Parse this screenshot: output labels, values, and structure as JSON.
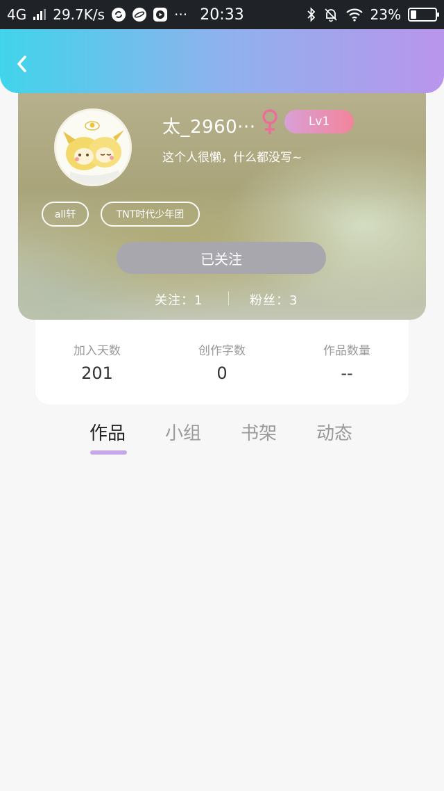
{
  "status_bar": {
    "network": "4G",
    "speed": "29.7K/s",
    "more": "···",
    "time": "20:33",
    "battery": "23%",
    "battery_level": 0.23,
    "icons": [
      "signal-icon",
      "sync-icon",
      "planet-icon",
      "play-icon",
      "bluetooth-icon",
      "mute-bell-icon",
      "wifi-icon",
      "battery-icon"
    ]
  },
  "header": {
    "back_icon": "chevron-left-icon",
    "colors": {
      "start": "#40d4ea",
      "mid": "#8eb2ed",
      "end": "#b995ec"
    }
  },
  "profile": {
    "username": "太_2960···",
    "gender_icon": "female-icon",
    "gender_color": "#e96f99",
    "level": "Lv1",
    "bio": "这个人很懒，什么都没写~",
    "tags": [
      "all轩",
      "TNT时代少年团"
    ],
    "follow_button": "已关注",
    "following_label": "关注：1",
    "fans_label": "粉丝：3"
  },
  "stats": [
    {
      "label": "加入天数",
      "value": "201"
    },
    {
      "label": "创作字数",
      "value": "0"
    },
    {
      "label": "作品数量",
      "value": "--"
    }
  ],
  "tabs": [
    {
      "label": "作品",
      "active": true
    },
    {
      "label": "小组",
      "active": false
    },
    {
      "label": "书架",
      "active": false
    },
    {
      "label": "动态",
      "active": false
    }
  ],
  "accent_color": "#c6a7e7"
}
